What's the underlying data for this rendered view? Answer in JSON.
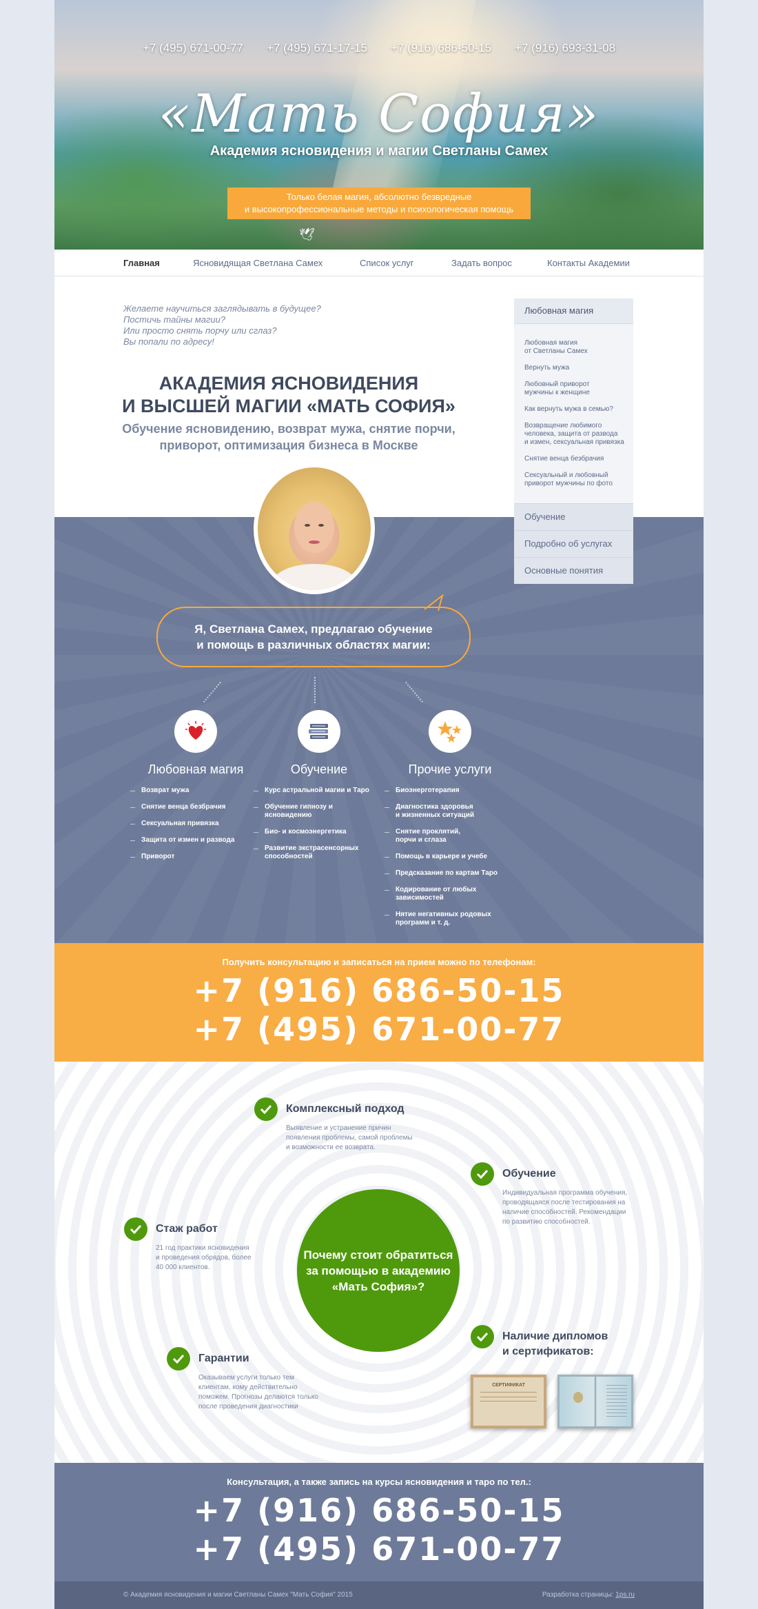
{
  "header": {
    "phones": [
      "+7 (495) 671-00-77",
      "+7 (495) 671-17-15",
      "+7 (916) 686-50-15",
      "+7 (916) 693-31-08"
    ],
    "logo": "«Мать София»",
    "tagline": "Академия ясновидения и магии Светланы Самех",
    "banner": "Только белая магия, абсолютно безвредные\nи высокопрофессиональные методы и психологическая помощь"
  },
  "nav": {
    "items": [
      {
        "label": "Главная"
      },
      {
        "label": "Ясновидящая Светлана Самех"
      },
      {
        "label": "Список услуг"
      },
      {
        "label": "Задать вопрос"
      },
      {
        "label": "Контакты Академии"
      }
    ]
  },
  "intro": {
    "questions": [
      "Желаете научиться заглядывать в будущее?",
      "Постичь тайны магии?",
      "Или просто снять порчу или сглаз?",
      "Вы попали по адресу!"
    ],
    "title_line1": "АКАДЕМИЯ ЯСНОВИДЕНИЯ",
    "title_line2": "И ВЫСШЕЙ МАГИИ «МАТЬ СОФИЯ»",
    "subtitle_line1": "Обучение ясновидению, возврат мужа, снятие порчи,",
    "subtitle_line2": "приворот, оптимизация бизнеса в Москве"
  },
  "sidebar": {
    "heading": "Любовная магия",
    "items": [
      "Любовная магия\nот Светланы Самех",
      "Вернуть мужа",
      "Любовный приворот\nмужчины к женщине",
      "Как вернуть мужа в семью?",
      "Возвращение любимого\nчеловека, защита от развода\nи измен, сексуальная привязка",
      "Снятие венца безбрачия",
      "Сексуальный и любовный\nприворот мужчины по фото"
    ],
    "links": [
      "Обучение",
      "Подробно об услугах",
      "Основные понятия"
    ]
  },
  "services": {
    "bubble": "Я, Светлана Самех, предлагаю обучение\nи помощь в различных областях магии:",
    "columns": [
      {
        "title": "Любовная магия",
        "icon": "heart-icon",
        "items": [
          "Возврат мужа",
          "Снятие венца безбрачия",
          "Сексуальная привязка",
          "Защита от измен и развода",
          "Приворот"
        ]
      },
      {
        "title": "Обучение",
        "icon": "books-icon",
        "items": [
          "Курс астральной магии и Таро",
          "Обучение гипнозу и\nясновидению",
          "Био- и космоэнергетика",
          "Развитие экстрасенсорных\nспособностей"
        ]
      },
      {
        "title": "Прочие услуги",
        "icon": "stars-icon",
        "items": [
          "Биоэнерготерапия",
          "Диагностика здоровья\nи жизненных ситуаций",
          "Снятие проклятий,\nпорчи и сглаза",
          "Помощь в карьере и учебе",
          "Предсказание по картам Таро",
          "Кодирование от любых\nзависимостей",
          "Нятие негативных родовых\nпрограмм и т. д."
        ]
      }
    ]
  },
  "contact1": {
    "label": "Получить консультацию и записаться на прием можно по телефонам:",
    "phone1": "+7 (916) 686-50-15",
    "phone2": "+7 (495) 671-00-77"
  },
  "why": {
    "center": "Почему стоит обратиться\nза помощью в академию\n«Мать София»?",
    "features": [
      {
        "title": "Комплексный подход",
        "desc": "Выявление и устранение причин\nпоявления проблемы, самой проблемы\nи возможности ее возврата."
      },
      {
        "title": "Обучение",
        "desc": "Индивидуальная программа обучения,\nпроводящаяся после тестирования на\nналичие способностей. Рекомендации\nпо развитию способностей."
      },
      {
        "title": "Стаж работ",
        "desc": "21 год практики ясновидения\nи проведения обрядов, более\n40 000 клиентов."
      },
      {
        "title": "Гарантии",
        "desc": "Оказываем услуги только тем\nклиентам, кому действительно\nпоможем. Прогнозы делаются только\nпосле проведения диагностики"
      },
      {
        "title": "Наличие дипломов\nи сертификатов:",
        "desc": ""
      }
    ],
    "cert_label": "СЕРТИФИКАТ"
  },
  "contact2": {
    "label": "Консультация, а также запись на курсы ясновидения и таро по тел.:",
    "phone1": "+7 (916) 686-50-15",
    "phone2": "+7 (495) 671-00-77"
  },
  "footer": {
    "copyright": "© Академия ясновидения и магии Светланы Самех \"Мать София\" 2015",
    "dev_label": "Разработка страницы:",
    "dev_link": "1ps.ru"
  },
  "colors": {
    "accent_orange": "#f9ad45",
    "slate_blue": "#6d7a99",
    "green": "#4f9a0c"
  }
}
